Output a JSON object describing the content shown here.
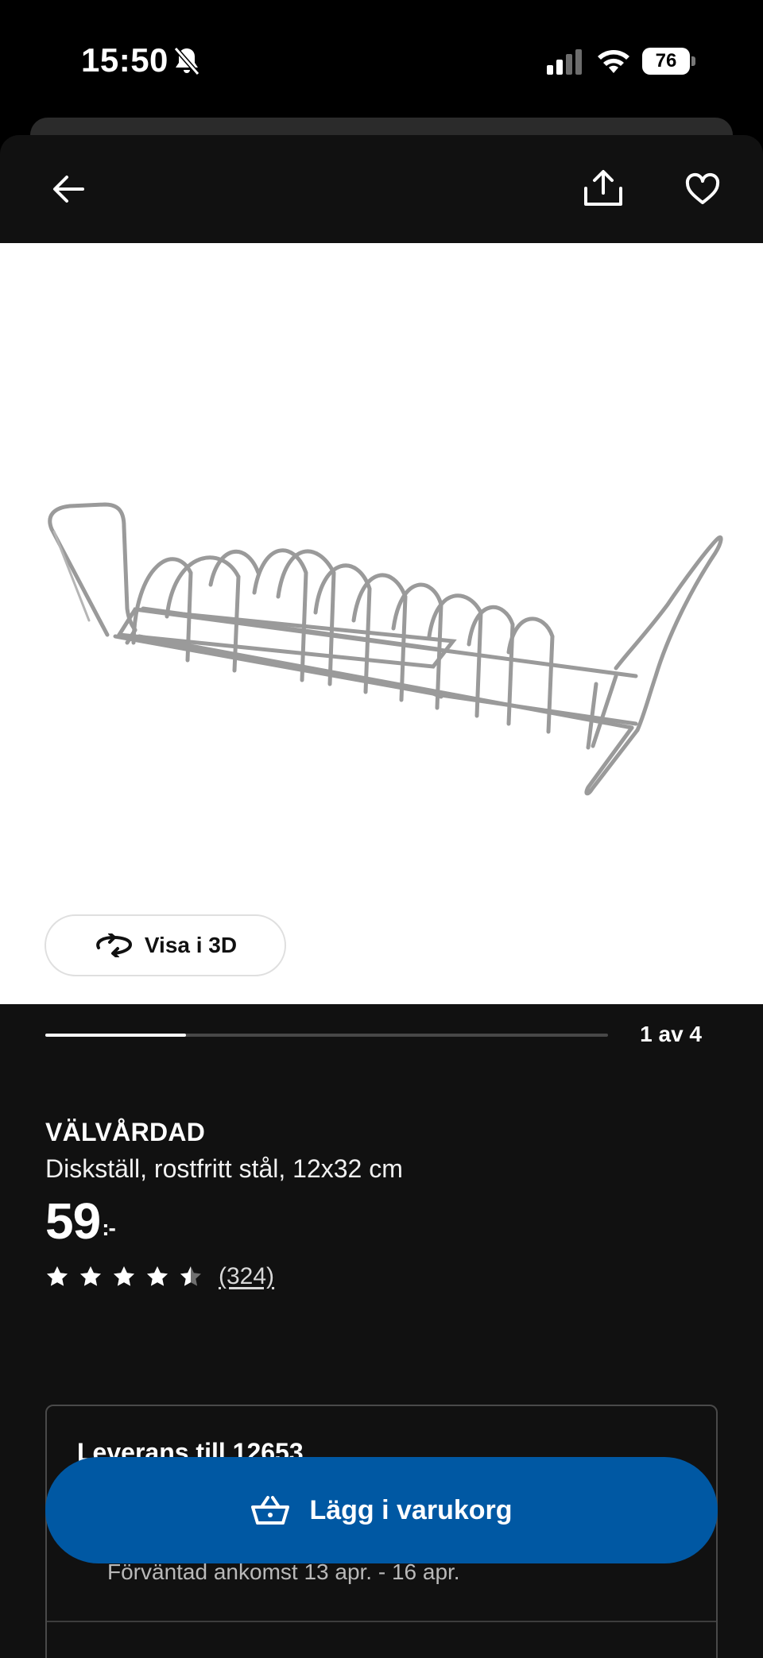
{
  "status_bar": {
    "time": "15:50",
    "battery": "76",
    "icons": [
      "bell-slash-icon",
      "cellular-signal-icon",
      "wifi-icon",
      "battery-icon"
    ]
  },
  "nav": {
    "icons": [
      "arrow-left-icon",
      "share-icon",
      "heart-icon"
    ]
  },
  "gallery": {
    "view_3d_label": "Visa i 3D",
    "page_counter": "1 av 4",
    "progress_fraction": 0.25
  },
  "product": {
    "name": "VÄLVÅRDAD",
    "description": "Diskställ, rostfritt stål, 12x32 cm",
    "price": "59",
    "price_suffix": ":-",
    "rating": 4.5,
    "review_count": "(324)"
  },
  "delivery": {
    "title": "Leverans till 12653",
    "eta": "Förväntad ankomst 13 apr. - 16 apr."
  },
  "cart_button": {
    "label": "Lägg i varukorg",
    "icon": "shopping-basket-icon"
  },
  "colors": {
    "background": "#111111",
    "accent": "#0058a3"
  }
}
